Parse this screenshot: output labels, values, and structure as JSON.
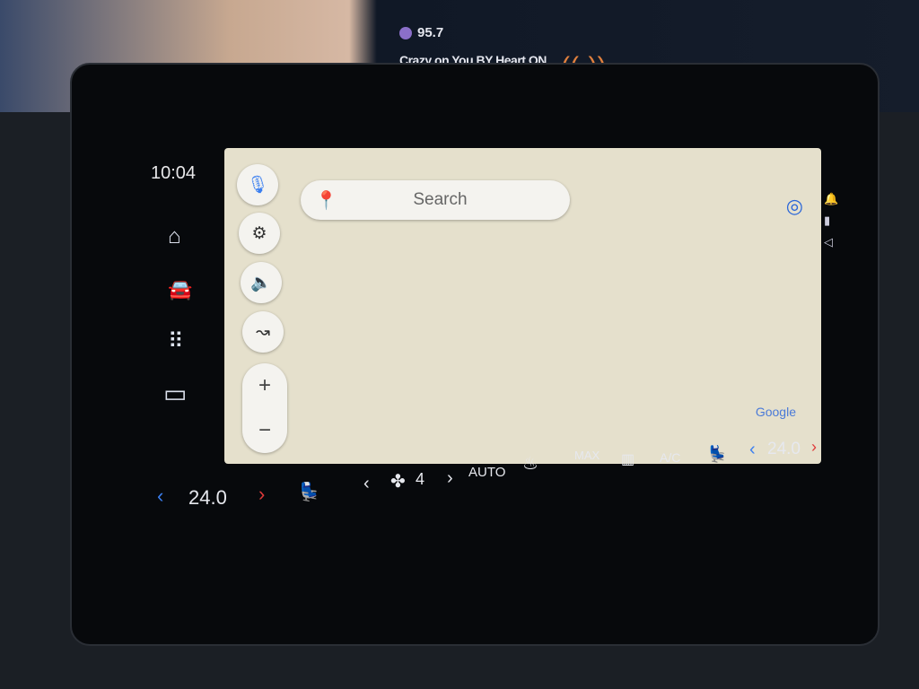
{
  "cluster": {
    "station_freq": "95.7",
    "now_playing": "Crazy on You BY Heart ON",
    "icons": [
      "radio-logo-icon",
      "antenna-icon"
    ],
    "accent": "#e0803e"
  },
  "rail": {
    "time": "10:04",
    "items": [
      {
        "name": "home-icon",
        "glyph": "⌂"
      },
      {
        "name": "car-icon",
        "glyph": "🚘"
      },
      {
        "name": "apps-grid-icon",
        "glyph": "⠿"
      },
      {
        "name": "split-view-icon",
        "glyph": "▭"
      }
    ]
  },
  "map": {
    "search_placeholder": "Search",
    "google_label": "Google",
    "fabs": [
      {
        "name": "microphone-icon",
        "glyph": "🎙"
      },
      {
        "name": "settings-icon",
        "glyph": "⚙"
      },
      {
        "name": "volume-icon",
        "glyph": "🔈"
      },
      {
        "name": "route-icon",
        "glyph": "↝"
      }
    ],
    "zoom_in": "+",
    "zoom_out": "−",
    "background": "#e5e0cc"
  },
  "status_icons": [
    "notification-bell-icon",
    "signal-icon",
    "navigation-arrow-icon"
  ],
  "climate": {
    "left_temp": "24.0",
    "right_temp": "24.0",
    "fan_speed": "4",
    "auto_label": "AUTO",
    "max_label": "MAX",
    "ac_label": "A/C",
    "dec": "‹",
    "inc": "›"
  }
}
